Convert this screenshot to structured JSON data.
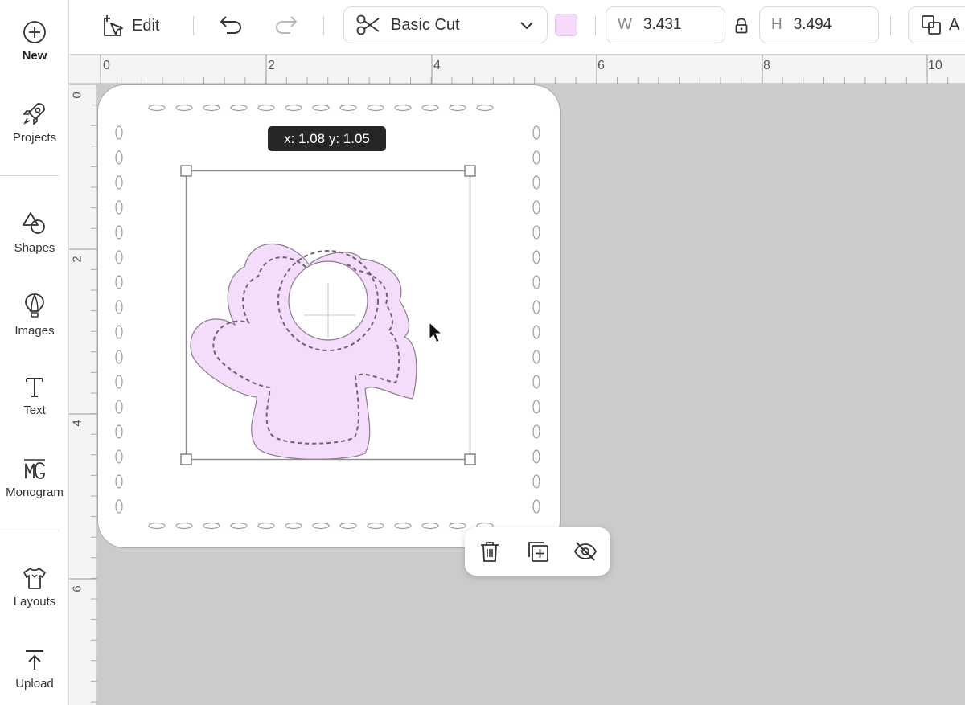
{
  "sidebar": {
    "items": [
      {
        "label": "New",
        "icon": "plus-circle-icon"
      },
      {
        "label": "Projects",
        "icon": "rocket-icon"
      },
      {
        "label": "Shapes",
        "icon": "shapes-icon"
      },
      {
        "label": "Images",
        "icon": "lightbulb-icon"
      },
      {
        "label": "Text",
        "icon": "text-icon"
      },
      {
        "label": "Monogram",
        "icon": "monogram-icon"
      },
      {
        "label": "Layouts",
        "icon": "tshirt-icon"
      },
      {
        "label": "Upload",
        "icon": "upload-icon"
      }
    ]
  },
  "toolbar": {
    "edit_label": "Edit",
    "operation": "Basic Cut",
    "swatch_color": "#f4dbfb",
    "width_label": "W",
    "width_value": "3.431",
    "height_label": "H",
    "height_value": "3.494",
    "arrange_partial": "A"
  },
  "rulers": {
    "top": [
      "0",
      "2",
      "4",
      "6",
      "8",
      "10"
    ],
    "left": [
      "0",
      "2",
      "4",
      "6"
    ]
  },
  "canvas": {
    "position_readout": "x: 1.08 y: 1.05",
    "fill_color": "#f4dcfb",
    "stroke_color": "#7c6b80"
  },
  "action_bar": {
    "buttons": [
      "delete-icon",
      "duplicate-icon",
      "hide-icon"
    ]
  }
}
